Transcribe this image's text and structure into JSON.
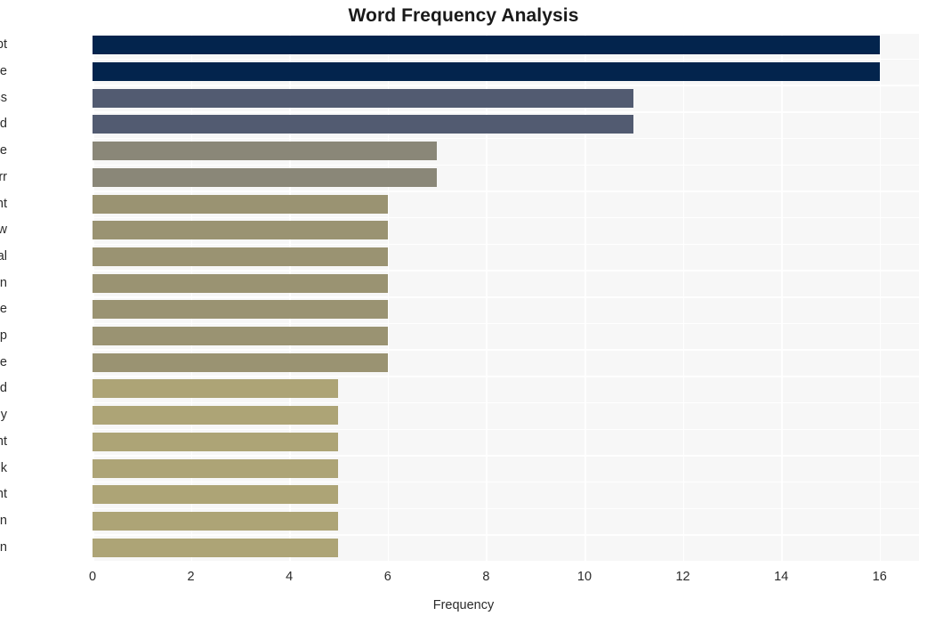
{
  "chart_data": {
    "type": "bar",
    "orientation": "horizontal",
    "title": "Word Frequency Analysis",
    "xlabel": "Frequency",
    "ylabel": "",
    "categories": [
      "contempt",
      "house",
      "congress",
      "garland",
      "prosecute",
      "barr",
      "government",
      "law",
      "general",
      "begin",
      "time",
      "trump",
      "cite",
      "understand",
      "attorney",
      "department",
      "seek",
      "president",
      "turn",
      "question"
    ],
    "values": [
      16,
      16,
      11,
      11,
      7,
      7,
      6,
      6,
      6,
      6,
      6,
      6,
      6,
      5,
      5,
      5,
      5,
      5,
      5,
      5
    ],
    "bar_colors": [
      "#03244d",
      "#03244d",
      "#525b71",
      "#525b71",
      "#8a8778",
      "#8a8778",
      "#9a9372",
      "#9a9372",
      "#9a9372",
      "#9a9372",
      "#9a9372",
      "#9a9372",
      "#9a9372",
      "#ada476",
      "#ada476",
      "#ada476",
      "#ada476",
      "#ada476",
      "#ada476",
      "#ada476"
    ],
    "xlim": [
      0,
      16.8
    ],
    "xticks": [
      0,
      2,
      4,
      6,
      8,
      10,
      12,
      14,
      16
    ],
    "xtick_labels": [
      "0",
      "2",
      "4",
      "6",
      "8",
      "10",
      "12",
      "14",
      "16"
    ],
    "grid": true,
    "grid_color": "#ffffff",
    "plot_background": "#f7f7f7",
    "figure_background": "#ffffff",
    "legend": null
  }
}
